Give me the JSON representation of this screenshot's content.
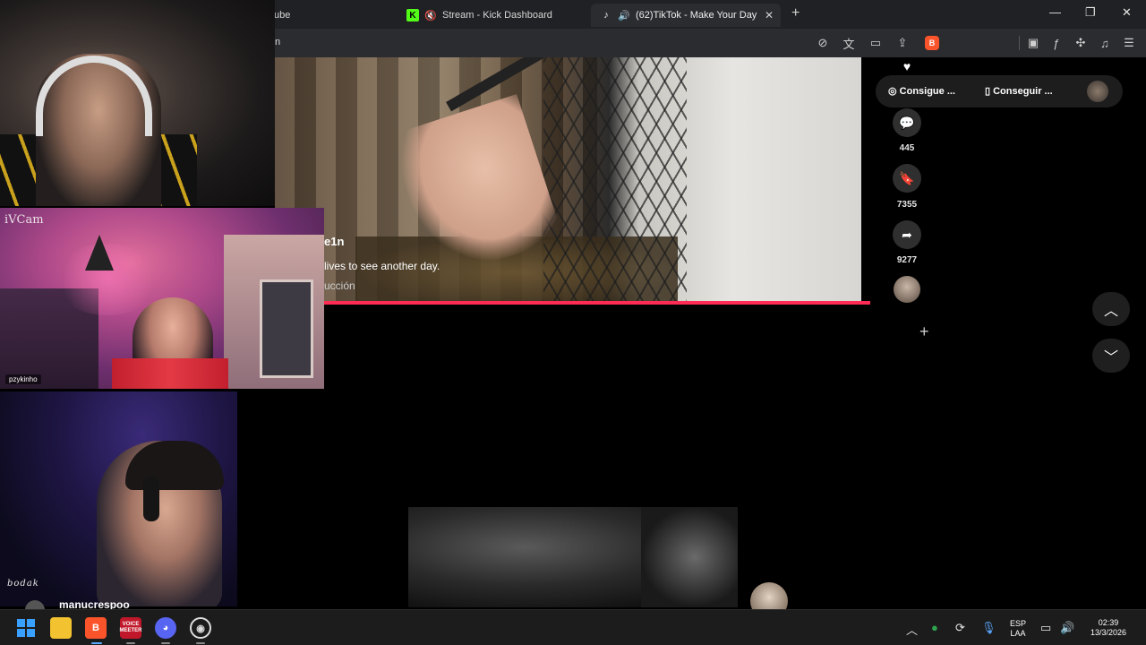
{
  "browser": {
    "tabs": [
      {
        "title": "ube",
        "icon": "youtube-icon"
      },
      {
        "title": "Stream - Kick Dashboard",
        "icon": "kick-icon"
      },
      {
        "title": "(62)TikTok - Make Your Day",
        "icon": "tiktok-icon",
        "active": true
      }
    ],
    "url_fragment": "n"
  },
  "tiktok": {
    "video": {
      "author": "e1n",
      "caption": "lives to see another day.",
      "music": "ucción",
      "progress_fraction": 1.0
    },
    "actions": {
      "comments": "445",
      "saves": "7355",
      "shares": "9277"
    },
    "promo": {
      "item1": "Consigue ...",
      "item2": "Conseguir ..."
    }
  },
  "overlays": {
    "cam2_label": "iVCam",
    "cam2_name": "pzykinho",
    "signature": "bodak",
    "chat_username": "manucrespoo"
  },
  "taskbar": {
    "apps": [
      "windows-start",
      "file-explorer",
      "brave",
      "voicemeeter",
      "discord",
      "obs"
    ],
    "voicemeeter_label": "VOICE MEETER",
    "lang_top": "ESP",
    "lang_bottom": "LAA",
    "time": "02:39",
    "date": "13/3/2026"
  },
  "colors": {
    "accent_progress": "#fe2c55",
    "kick": "#53fc18",
    "brave": "#fb542b",
    "discord": "#5865f2"
  }
}
